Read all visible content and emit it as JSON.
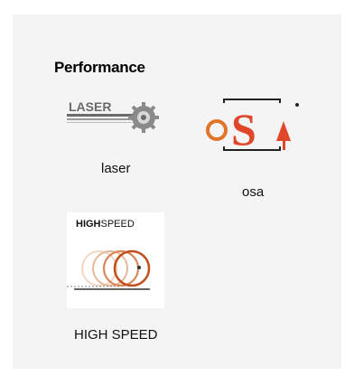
{
  "section": {
    "title": "Performance"
  },
  "features": [
    {
      "name": "laser",
      "caption": "laser",
      "logo_text": "LASER"
    },
    {
      "name": "osa",
      "caption": "osa",
      "logo_text": "oSA"
    },
    {
      "name": "high-speed",
      "caption": "HIGH SPEED",
      "logo_text_bold": "HIGH",
      "logo_text_regular": "SPEED"
    }
  ],
  "colors": {
    "panel_bg": "#f4f4f4",
    "osa_orange": "#e2742a",
    "osa_red": "#e0462a",
    "highspeed_ring": "#c1501e"
  },
  "icons": [
    "laser-gear-icon",
    "osa-logo-icon",
    "high-speed-circles-icon"
  ]
}
